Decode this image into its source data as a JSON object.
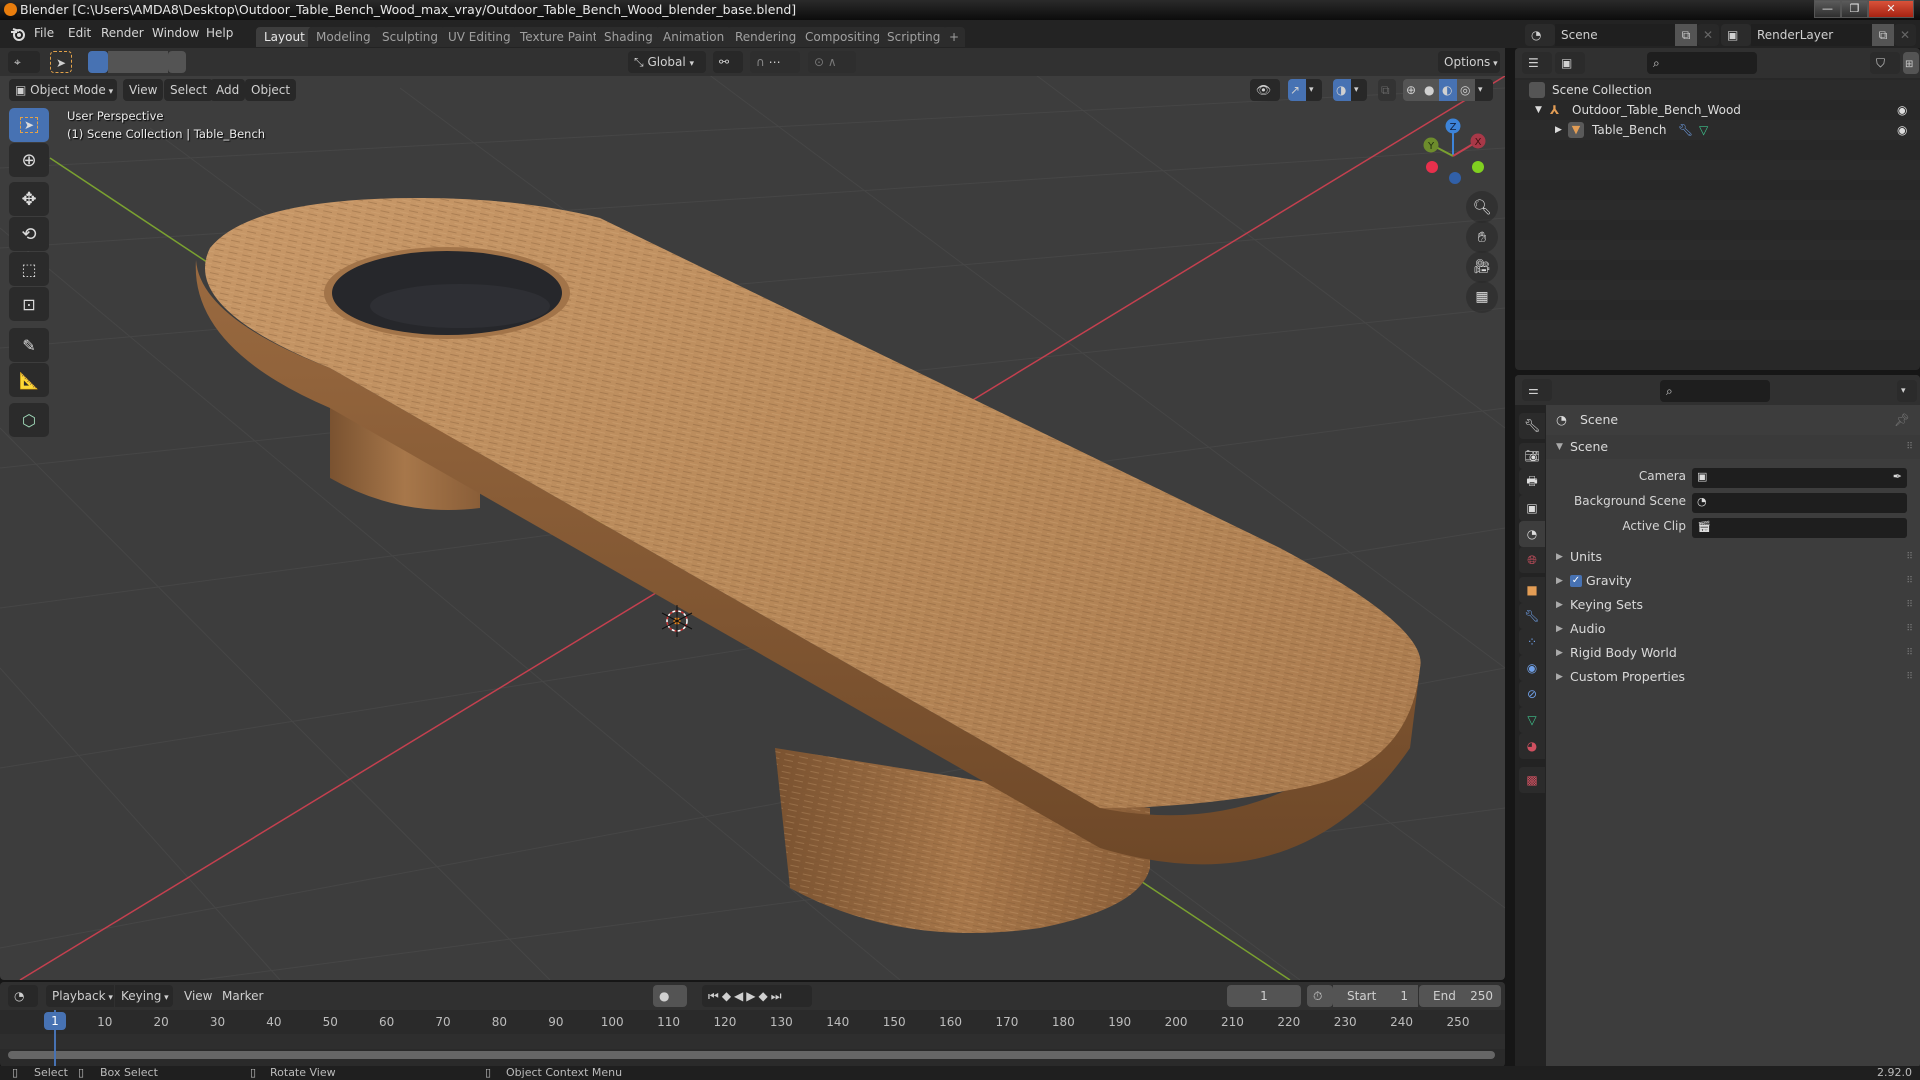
{
  "window": {
    "title": "Blender [C:\\Users\\AMDA8\\Desktop\\Outdoor_Table_Bench_Wood_max_vray/Outdoor_Table_Bench_Wood_blender_base.blend]",
    "controls": {
      "minimize": "—",
      "maximize": "❐",
      "close": "✕"
    }
  },
  "menubar": {
    "items": [
      "File",
      "Edit",
      "Render",
      "Window",
      "Help"
    ],
    "workspaces": [
      "Layout",
      "Modeling",
      "Sculpting",
      "UV Editing",
      "Texture Paint",
      "Shading",
      "Animation",
      "Rendering",
      "Compositing",
      "Scripting"
    ],
    "active_workspace": "Layout",
    "add_workspace": "+",
    "scene": "Scene",
    "view_layer": "RenderLayer"
  },
  "viewport": {
    "transform_orientation": "Global",
    "options_label": "Options",
    "mode": "Object Mode",
    "menus": [
      "View",
      "Select",
      "Add",
      "Object"
    ],
    "overlay_title": "User Perspective",
    "overlay_subtitle": "(1) Scene Collection | Table_Bench",
    "gizmo_axes": {
      "x": "X",
      "y": "Y",
      "z": "Z"
    },
    "colors": {
      "background": "#3d3d3d",
      "x_axis": "#c4404f",
      "y_axis": "#7aa130",
      "z_axis": "#3d84d9",
      "active_tool": "#4772b3",
      "wood": "#b98a5a"
    }
  },
  "toolbar": {
    "tools": [
      "select-box",
      "cursor",
      "move",
      "rotate",
      "scale",
      "transform",
      "annotate",
      "measure",
      "add-cube"
    ],
    "active": "select-box"
  },
  "outliner": {
    "root": "Scene Collection",
    "items": [
      {
        "name": "Outdoor_Table_Bench_Wood",
        "type": "empty",
        "expanded": true,
        "visible": true
      },
      {
        "name": "Table_Bench",
        "type": "mesh",
        "expanded": false,
        "visible": true
      }
    ]
  },
  "properties": {
    "context": "Scene",
    "panel_title": "Scene",
    "fields": [
      {
        "label": "Camera",
        "value": ""
      },
      {
        "label": "Background Scene",
        "value": ""
      },
      {
        "label": "Active Clip",
        "value": ""
      }
    ],
    "subpanels": [
      {
        "label": "Units",
        "checkbox": null
      },
      {
        "label": "Gravity",
        "checkbox": true
      },
      {
        "label": "Keying Sets",
        "checkbox": null
      },
      {
        "label": "Audio",
        "checkbox": null
      },
      {
        "label": "Rigid Body World",
        "checkbox": null
      },
      {
        "label": "Custom Properties",
        "checkbox": null
      }
    ]
  },
  "timeline": {
    "menus": [
      "Playback",
      "Keying",
      "View",
      "Marker"
    ],
    "current_frame": "1",
    "start_label": "Start",
    "start": "1",
    "end_label": "End",
    "end": "250",
    "ticks": [
      "10",
      "20",
      "30",
      "40",
      "50",
      "60",
      "70",
      "80",
      "90",
      "100",
      "110",
      "120",
      "130",
      "140",
      "150",
      "160",
      "170",
      "180",
      "190",
      "200",
      "210",
      "220",
      "230",
      "240",
      "250"
    ],
    "playhead": "1"
  },
  "statusbar": {
    "hints": [
      "Select",
      "Box Select",
      "Rotate View",
      "Object Context Menu"
    ],
    "version": "2.92.0"
  }
}
